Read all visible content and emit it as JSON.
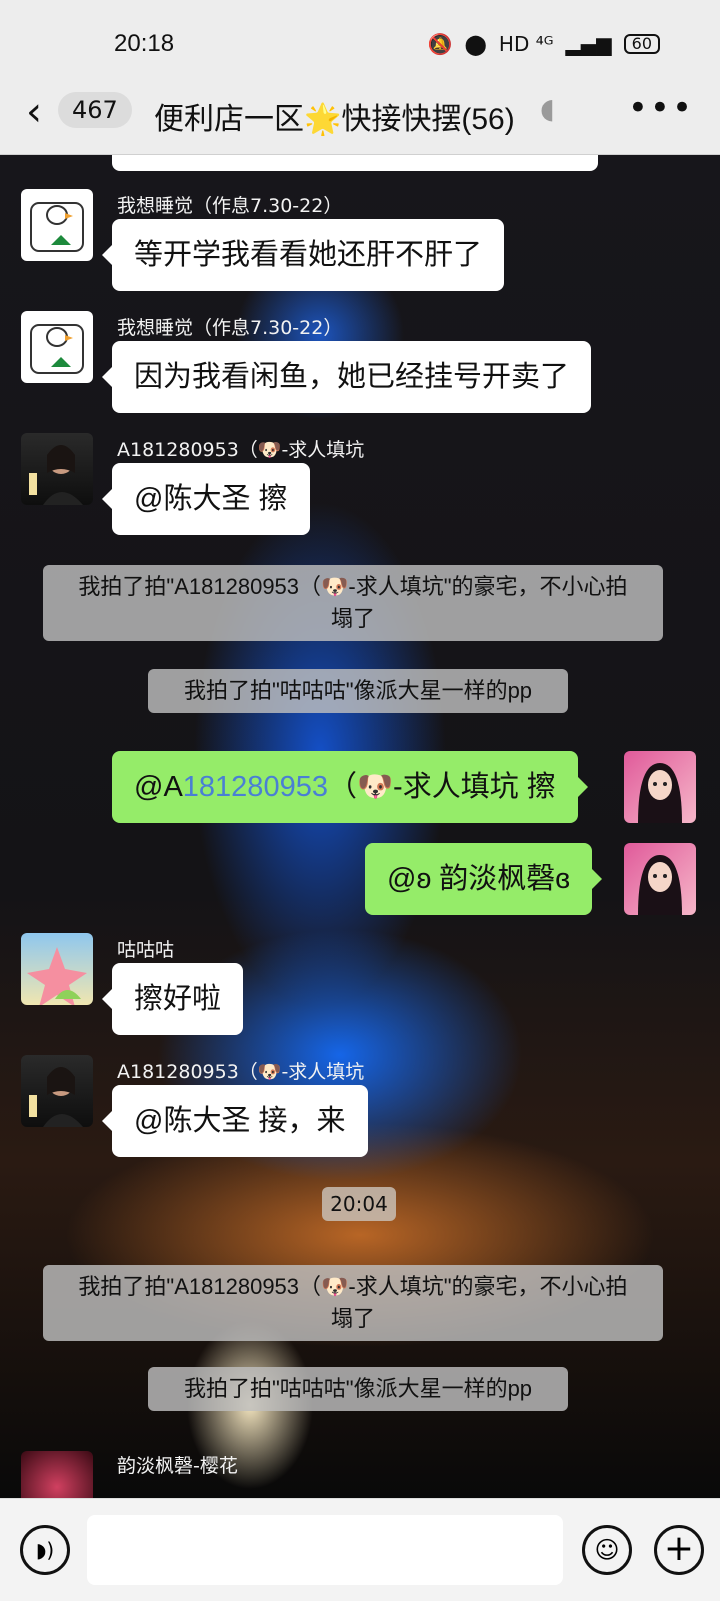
{
  "status_bar": {
    "time": "20:18",
    "network": "HD ⁴ᴳ",
    "battery": "60"
  },
  "header": {
    "back_count": "467",
    "title": "便利店一区🌟快接快摆(56)"
  },
  "messages": {
    "m1": {
      "sender": "我想睡觉（作息7.30-22）",
      "text": "等开学我看看她还肝不肝了"
    },
    "m2": {
      "sender": "我想睡觉（作息7.30-22）",
      "text": "因为我看闲鱼，她已经挂号开卖了"
    },
    "m3": {
      "sender": "A181280953（🐶-求人填坑",
      "text": "@陈大圣  擦"
    },
    "s1": {
      "line1": "我拍了拍\"A181280953（🐶-求人填坑\"的豪宅，不小心拍",
      "line2": "塌了"
    },
    "s2": {
      "text": "我拍了拍\"咕咕咕\"像派大星一样的pp"
    },
    "m4": {
      "text_a": "@A",
      "text_b": "181280953",
      "text_c": "（🐶-求人填坑  擦"
    },
    "m5": {
      "text": "@ʚ 韵淡枫磬ɞ"
    },
    "m6": {
      "sender": "咕咕咕",
      "text": "擦好啦"
    },
    "m7": {
      "sender": "A181280953（🐶-求人填坑",
      "text": "@陈大圣  接，来"
    },
    "timestamp": "20:04",
    "s3": {
      "line1": "我拍了拍\"A181280953（🐶-求人填坑\"的豪宅，不小心拍",
      "line2": "塌了"
    },
    "s4": {
      "text": "我拍了拍\"咕咕咕\"像派大星一样的pp"
    },
    "m8": {
      "sender": "韵淡枫磬-樱花"
    }
  },
  "colors": {
    "accent_green": "#95ec69",
    "header_bg": "#ededed"
  }
}
